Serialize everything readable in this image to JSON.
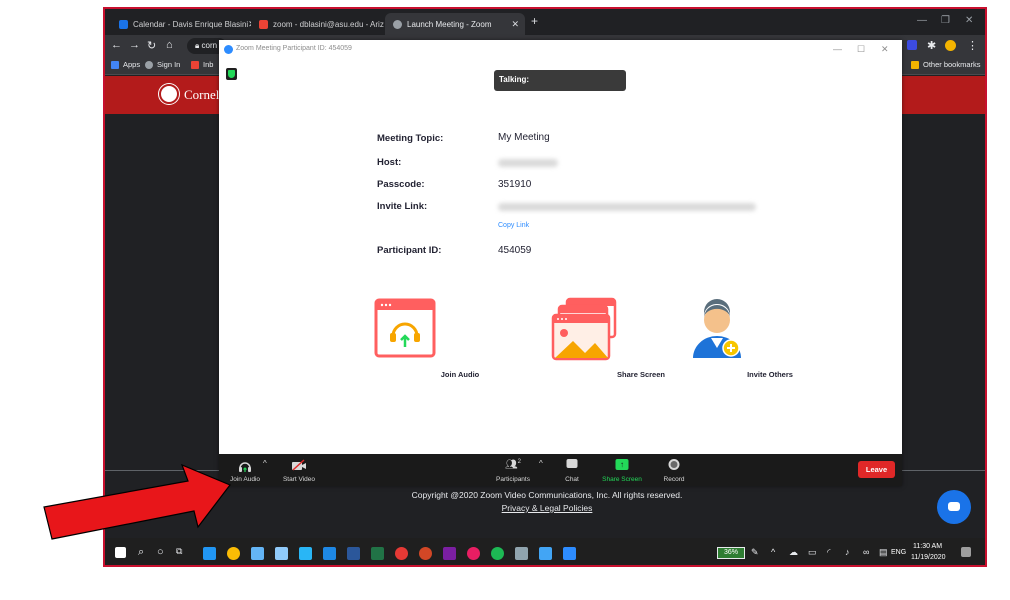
{
  "browser": {
    "tabs": [
      {
        "title": "Calendar - Davis Enrique Blasini",
        "close": "✕"
      },
      {
        "title": "zoom - dblasini@asu.edu - Ariz",
        "close": "✕"
      },
      {
        "title": "Launch Meeting - Zoom",
        "close": "✕"
      }
    ],
    "new_tab": "+",
    "address_partial": "corn",
    "bookmarks": {
      "apps": "Apps",
      "signin": "Sign In",
      "inbox": "Inb",
      "other": "Other bookmarks"
    }
  },
  "site": {
    "banner_text": "Cornell",
    "copyright": "Copyright @2020 Zoom Video Communications, Inc. All rights reserved.",
    "privacy": "Privacy & Legal Policies"
  },
  "zoom": {
    "window_title": "Zoom Meeting Participant ID: 454059",
    "talking_label": "Talking:",
    "info": {
      "topic_label": "Meeting Topic:",
      "topic_value": "My Meeting",
      "host_label": "Host:",
      "passcode_label": "Passcode:",
      "passcode_value": "351910",
      "invite_label": "Invite Link:",
      "copy_link": "Copy Link",
      "participant_label": "Participant ID:",
      "participant_value": "454059"
    },
    "actions": {
      "join_audio": "Join Audio",
      "share_screen": "Share Screen",
      "invite_others": "Invite Others"
    },
    "toolbar": {
      "join_audio": "Join Audio",
      "start_video": "Start Video",
      "participants": "Participants",
      "participants_count": "2",
      "chat": "Chat",
      "share_screen": "Share Screen",
      "record": "Record",
      "leave": "Leave"
    }
  },
  "taskbar": {
    "battery": "36%",
    "language": "ENG",
    "time": "11:30 AM",
    "date": "11/19/2020"
  },
  "colors": {
    "zoom_blue": "#2d8cff",
    "zoom_green": "#23d959",
    "leave_red": "#e02828",
    "cornell_red": "#b31b1b",
    "arrow_red": "#e8161a"
  }
}
